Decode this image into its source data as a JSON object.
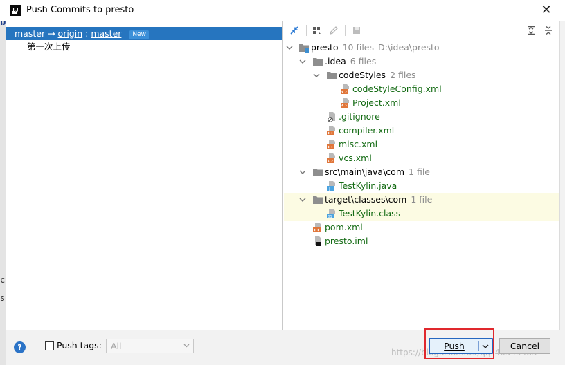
{
  "window": {
    "title": "Push Commits to presto",
    "icon": "intellij-idea-icon"
  },
  "background": {
    "letters": [
      "b",
      "ck",
      "st"
    ]
  },
  "left": {
    "branch": {
      "local": "master",
      "arrow": "→",
      "remote": "origin",
      "sep": ":",
      "target": "master",
      "badge": "New"
    },
    "commits": [
      "第一次上传"
    ]
  },
  "right": {
    "toolbar": [
      "expand-collapse-icon",
      "group-by-icon",
      "edit-icon",
      "save-icon",
      "expand-all-icon",
      "collapse-all-icon"
    ],
    "tree": [
      {
        "name": "presto",
        "count": "10 files",
        "path": "D:\\idea\\presto"
      },
      {
        "name": ".idea",
        "count": "6 files"
      },
      {
        "name": "codeStyles",
        "count": "2 files"
      },
      {
        "name": "codeStyleConfig.xml"
      },
      {
        "name": "Project.xml"
      },
      {
        "name": ".gitignore"
      },
      {
        "name": "compiler.xml"
      },
      {
        "name": "misc.xml"
      },
      {
        "name": "vcs.xml"
      },
      {
        "name": "src\\main\\java\\com",
        "count": "1 file"
      },
      {
        "name": "TestKylin.java"
      },
      {
        "name": "target\\classes\\com",
        "count": "1 file"
      },
      {
        "name": "TestKylin.class"
      },
      {
        "name": "pom.xml"
      },
      {
        "name": "presto.iml"
      }
    ]
  },
  "bottom": {
    "help": "?",
    "push_tags_label": "Push tags:",
    "tags_value": "All",
    "push_label": "Push",
    "cancel_label": "Cancel",
    "watermark": "https://blog.csdn.net/qq_40549485"
  },
  "colors": {
    "selection": "#2675bf",
    "added_file": "#146b14",
    "highlight_row": "#fcfbe3",
    "annotation_red": "#e0282d"
  }
}
